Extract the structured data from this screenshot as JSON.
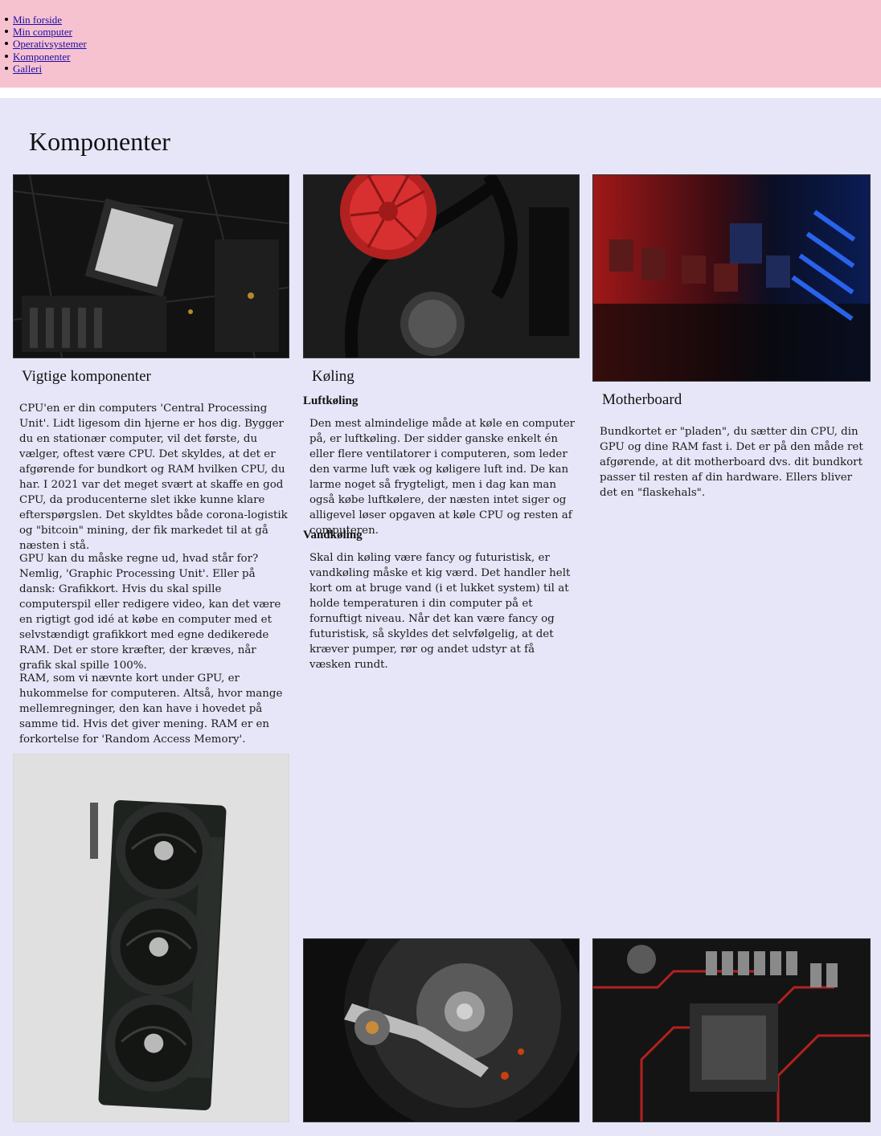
{
  "nav": {
    "items": [
      {
        "label": "Min forside"
      },
      {
        "label": "Min computer"
      },
      {
        "label": "Operativsystemer"
      },
      {
        "label": "Komponenter"
      },
      {
        "label": "Galleri"
      }
    ]
  },
  "page": {
    "title": "Komponenter"
  },
  "col1": {
    "image_alt": "CPU",
    "title": "Vigtige komponenter",
    "paragraphs": [
      "CPU'en er din computers 'Central Processing Unit'. Lidt ligesom din hjerne er hos dig. Bygger du en stationær computer, vil det første, du vælger, oftest være CPU. Det skyldes, at det er afgørende for bundkort og RAM hvilken CPU, du har. I 2021 var det meget svært at skaffe en god CPU, da producenterne slet ikke kunne klare efterspørgslen. Det skyldtes både corona-logistik og \"bitcoin\" mining, der fik markedet til at gå næsten i stå.",
      "GPU kan du måske regne ud, hvad står for? Nemlig, 'Graphic Processing Unit'. Eller på dansk: Grafikkort. Hvis du skal spille computerspil eller redigere video, kan det være en rigtigt god idé at købe en computer med et selvstændigt grafikkort med egne dedikerede RAM. Det er store kræfter, der kræves, når grafik skal spille 100%.",
      "RAM, som vi nævnte kort under GPU, er hukommelse for computeren. Altså, hvor mange mellemregninger, den kan have i hovedet på samme tid. Hvis det giver mening. RAM er en forkortelse for 'Random Access Memory'."
    ]
  },
  "col2": {
    "title": "Køling",
    "sub1": "Luftkøling",
    "text1": "Den mest almindelige måde at køle en computer på, er luftkøling. Der sidder ganske enkelt én eller flere ventilatorer i computeren, som leder den varme luft væk og køligere luft ind. De kan larme noget så frygteligt, men i dag kan man også købe luftkølere, der næsten intet siger og alligevel løser opgaven at køle CPU og resten af computeren.",
    "sub2": "Vandkøling",
    "text2": "Skal din køling være fancy og futuristisk, er vandkøling måske et kig værd. Det handler helt kort om at bruge vand (i et lukket system) til at holde temperaturen i din computer på et fornuftigt niveau. Når det kan være fancy og futuristisk, så skyldes det selvfølgelig, at det kræver pumper, rør og andet udstyr at få væsken rundt."
  },
  "col3": {
    "title": "Motherboard",
    "text": "Bundkortet er \"pladen\", du sætter din CPU, din GPU og dine RAM fast i. Det er på den måde ret afgørende, at dit motherboard dvs. dit bundkort passer til resten af din hardware. Ellers bliver det en \"flaskehals\"."
  },
  "colors": {
    "nav_bg": "#f7c2cf",
    "main_bg": "#e6e6f8",
    "link": "#1a0dab"
  }
}
